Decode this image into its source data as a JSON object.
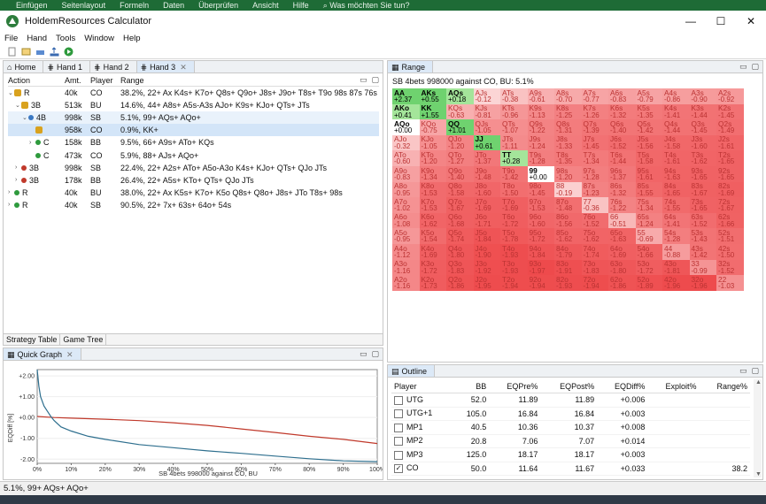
{
  "ribbon": [
    "Einfügen",
    "Seitenlayout",
    "Formeln",
    "Daten",
    "Überprüfen",
    "Ansicht",
    "Hilfe",
    "Was möchten Sie tun?"
  ],
  "window": {
    "title": "HoldemResources Calculator",
    "min": "—",
    "max": "☐",
    "close": "✕"
  },
  "menu": [
    "File",
    "Hand",
    "Tools",
    "Window",
    "Help"
  ],
  "left_tabs": [
    "Home",
    "Hand 1",
    "Hand 2",
    "Hand 3"
  ],
  "tree": {
    "headers": {
      "action": "Action",
      "amt": "Amt.",
      "player": "Player",
      "range": "Range"
    },
    "rows": [
      {
        "action": "R",
        "amt": "40k",
        "player": "CO",
        "range": "38.2%, 22+ Ax K4s+ K7o+ Q8s+ Q9o+ J8s+ J9o+ T8s+ T9o 98s 87s 76s 65s"
      },
      {
        "action": "3B",
        "amt": "513k",
        "player": "BU",
        "range": "14.6%, 44+ A8s+ A5s-A3s AJo+ K9s+ KJo+ QTs+ JTs"
      },
      {
        "action": "4B",
        "amt": "998k",
        "player": "SB",
        "range": "5.1%, 99+ AQs+ AQo+"
      },
      {
        "action": "",
        "amt": "958k",
        "player": "CO",
        "range": "0.9%, KK+"
      },
      {
        "action": "C",
        "amt": "158k",
        "player": "BB",
        "range": "9.5%, 66+ A9s+ ATo+ KQs"
      },
      {
        "action": "C",
        "amt": "473k",
        "player": "CO",
        "range": "5.9%, 88+ AJs+ AQo+"
      },
      {
        "action": "3B",
        "amt": "998k",
        "player": "SB",
        "range": "22.4%, 22+ A2s+ ATo+ A5o-A3o K4s+ KJo+ QTs+ QJo JTs"
      },
      {
        "action": "3B",
        "amt": "178k",
        "player": "BB",
        "range": "26.4%, 22+ A5s+ KTo+ QTs+ QJo JTs"
      },
      {
        "action": "R",
        "amt": "40k",
        "player": "BU",
        "range": "38.0%, 22+ Ax K5s+ K7o+ K5o Q8s+ Q8o+ J8s+ JTo T8s+ 98s"
      },
      {
        "action": "R",
        "amt": "40k",
        "player": "SB",
        "range": "90.5%, 22+ 7x+ 63s+ 64o+ 54s"
      }
    ]
  },
  "bottom_tabs": [
    "Strategy Table",
    "Game Tree"
  ],
  "quick_graph": {
    "tab": "Quick Graph",
    "chart_data": {
      "type": "line",
      "xlabel": "SB 4bets 998000 against CO, BU",
      "ylabel": "EQDiff [%]",
      "x_ticks": [
        "0%",
        "10%",
        "20%",
        "30%",
        "40%",
        "50%",
        "60%",
        "70%",
        "80%",
        "90%",
        "100%"
      ],
      "y_ticks": [
        "+2.00",
        "+1.00",
        "+0.00",
        "-1.00",
        "-2.00"
      ],
      "ylim": [
        -2.2,
        2.3
      ],
      "series": [
        {
          "color": "#c0392b",
          "x": [
            0,
            5,
            10,
            20,
            30,
            40,
            50,
            60,
            70,
            80,
            90,
            100
          ],
          "y": [
            0.05,
            0.0,
            -0.03,
            -0.08,
            -0.15,
            -0.25,
            -0.38,
            -0.55,
            -0.72,
            -0.9,
            -1.05,
            -1.25
          ]
        },
        {
          "color": "#2e6f8e",
          "x": [
            0,
            0.5,
            1,
            2,
            3,
            4,
            5,
            7,
            10,
            15,
            20,
            30,
            40,
            50,
            60,
            70,
            80,
            90,
            100
          ],
          "y": [
            2.3,
            1.5,
            1.0,
            0.55,
            0.3,
            0.05,
            -0.15,
            -0.45,
            -0.65,
            -0.9,
            -1.05,
            -1.3,
            -1.45,
            -1.6,
            -1.72,
            -1.85,
            -1.98,
            -2.08,
            -2.12
          ]
        }
      ]
    }
  },
  "range_panel": {
    "tab": "Range",
    "header": "SB 4bets 998000 against CO, BU: 5.1%",
    "cells": [
      [
        "AA",
        "+2.37"
      ],
      [
        "AKs",
        "+0.55"
      ],
      [
        "AQs",
        "+0.18"
      ],
      [
        "AJs",
        "-0.12"
      ],
      [
        "ATs",
        "-0.38"
      ],
      [
        "A9s",
        "-0.61"
      ],
      [
        "A8s",
        "-0.70"
      ],
      [
        "A7s",
        "-0.77"
      ],
      [
        "A6s",
        "-0.83"
      ],
      [
        "A5s",
        "-0.79"
      ],
      [
        "A4s",
        "-0.86"
      ],
      [
        "A3s",
        "-0.90"
      ],
      [
        "A2s",
        "-0.92"
      ],
      [
        "AKo",
        "+0.41"
      ],
      [
        "KK",
        "+1.55"
      ],
      [
        "KQs",
        "-0.63"
      ],
      [
        "KJs",
        "-0.81"
      ],
      [
        "KTs",
        "-0.96"
      ],
      [
        "K9s",
        "-1.13"
      ],
      [
        "K8s",
        "-1.25"
      ],
      [
        "K7s",
        "-1.26"
      ],
      [
        "K6s",
        "-1.32"
      ],
      [
        "K5s",
        "-1.35"
      ],
      [
        "K4s",
        "-1.41"
      ],
      [
        "K3s",
        "-1.44"
      ],
      [
        "K2s",
        "-1.45"
      ],
      [
        "AQo",
        "+0.00"
      ],
      [
        "KQo",
        "-0.75"
      ],
      [
        "QQ",
        "+1.01"
      ],
      [
        "QJs",
        "-1.05"
      ],
      [
        "QTs",
        "-1.07"
      ],
      [
        "Q9s",
        "-1.22"
      ],
      [
        "Q8s",
        "-1.31"
      ],
      [
        "Q7s",
        "-1.39"
      ],
      [
        "Q6s",
        "-1.40"
      ],
      [
        "Q5s",
        "-1.42"
      ],
      [
        "Q4s",
        "-1.44"
      ],
      [
        "Q3s",
        "-1.45"
      ],
      [
        "Q2s",
        "-1.49"
      ],
      [
        "AJo",
        "-0.32"
      ],
      [
        "KJo",
        "-1.05"
      ],
      [
        "QJo",
        "-1.20"
      ],
      [
        "JJ",
        "+0.61"
      ],
      [
        "JTs",
        "-1.11"
      ],
      [
        "J9s",
        "-1.24"
      ],
      [
        "J8s",
        "-1.33"
      ],
      [
        "J7s",
        "-1.45"
      ],
      [
        "J6s",
        "-1.52"
      ],
      [
        "J5s",
        "-1.56"
      ],
      [
        "J4s",
        "-1.58"
      ],
      [
        "J3s",
        "-1.60"
      ],
      [
        "J2s",
        "-1.61"
      ],
      [
        "ATo",
        "-0.60"
      ],
      [
        "KTo",
        "-1.20"
      ],
      [
        "QTo",
        "-1.27"
      ],
      [
        "JTo",
        "-1.37"
      ],
      [
        "TT",
        "+0.28"
      ],
      [
        "T9s",
        "-1.28"
      ],
      [
        "T8s",
        "-1.35"
      ],
      [
        "T7s",
        "-1.34"
      ],
      [
        "T6s",
        "-1.44"
      ],
      [
        "T5s",
        "-1.58"
      ],
      [
        "T4s",
        "-1.61"
      ],
      [
        "T3s",
        "-1.62"
      ],
      [
        "T2s",
        "-1.65"
      ],
      [
        "A9o",
        "-0.83"
      ],
      [
        "K9o",
        "-1.34"
      ],
      [
        "Q9o",
        "-1.40"
      ],
      [
        "J9o",
        "-1.48"
      ],
      [
        "T9o",
        "-1.42"
      ],
      [
        "99",
        "+0.00"
      ],
      [
        "98s",
        "-1.20"
      ],
      [
        "97s",
        "-1.28"
      ],
      [
        "96s",
        "-1.37"
      ],
      [
        "95s",
        "-1.61"
      ],
      [
        "94s",
        "-1.63"
      ],
      [
        "93s",
        "-1.65"
      ],
      [
        "92s",
        "-1.65"
      ],
      [
        "A8o",
        "-0.95"
      ],
      [
        "K8o",
        "-1.53"
      ],
      [
        "Q8o",
        "-1.58"
      ],
      [
        "J8o",
        "-1.60"
      ],
      [
        "T8o",
        "-1.50"
      ],
      [
        "98o",
        "-1.45"
      ],
      [
        "88",
        "-0.19"
      ],
      [
        "87s",
        "-1.23"
      ],
      [
        "86s",
        "-1.32"
      ],
      [
        "85s",
        "-1.55"
      ],
      [
        "84s",
        "-1.65"
      ],
      [
        "83s",
        "-1.67"
      ],
      [
        "82s",
        "-1.69"
      ],
      [
        "A7o",
        "-1.02"
      ],
      [
        "K7o",
        "-1.53"
      ],
      [
        "Q7o",
        "-1.67"
      ],
      [
        "J7o",
        "-1.69"
      ],
      [
        "T7o",
        "-1.69"
      ],
      [
        "97o",
        "-1.53"
      ],
      [
        "87o",
        "-1.48"
      ],
      [
        "77",
        "-0.36"
      ],
      [
        "76s",
        "-1.22"
      ],
      [
        "75s",
        "-1.34"
      ],
      [
        "74s",
        "-1.55"
      ],
      [
        "73s",
        "-1.65"
      ],
      [
        "72s",
        "-1.67"
      ],
      [
        "A6o",
        "-1.08"
      ],
      [
        "K6o",
        "-1.62"
      ],
      [
        "Q6o",
        "-1.68"
      ],
      [
        "J6o",
        "-1.71"
      ],
      [
        "T6o",
        "-1.72"
      ],
      [
        "96o",
        "-1.60"
      ],
      [
        "86o",
        "-1.56"
      ],
      [
        "76o",
        "-1.52"
      ],
      [
        "66",
        "-0.51"
      ],
      [
        "65s",
        "-1.24"
      ],
      [
        "64s",
        "-1.41"
      ],
      [
        "63s",
        "-1.52"
      ],
      [
        "62s",
        "-1.66"
      ],
      [
        "A5o",
        "-0.95"
      ],
      [
        "K5o",
        "-1.54"
      ],
      [
        "Q5o",
        "-1.74"
      ],
      [
        "J5o",
        "-1.84"
      ],
      [
        "T5o",
        "-1.78"
      ],
      [
        "95o",
        "-1.72"
      ],
      [
        "85o",
        "-1.62"
      ],
      [
        "75o",
        "-1.62"
      ],
      [
        "65o",
        "-1.63"
      ],
      [
        "55",
        "-0.69"
      ],
      [
        "54s",
        "-1.28"
      ],
      [
        "53s",
        "-1.43"
      ],
      [
        "52s",
        "-1.51"
      ],
      [
        "A4o",
        "-1.12"
      ],
      [
        "K4o",
        "-1.69"
      ],
      [
        "Q4o",
        "-1.80"
      ],
      [
        "J4o",
        "-1.90"
      ],
      [
        "T4o",
        "-1.93"
      ],
      [
        "94o",
        "-1.84"
      ],
      [
        "84o",
        "-1.79"
      ],
      [
        "74o",
        "-1.74"
      ],
      [
        "64o",
        "-1.69"
      ],
      [
        "54o",
        "-1.66"
      ],
      [
        "44",
        "-0.88"
      ],
      [
        "43s",
        "-1.42"
      ],
      [
        "42s",
        "-1.50"
      ],
      [
        "A3o",
        "-1.16"
      ],
      [
        "K3o",
        "-1.72"
      ],
      [
        "Q3o",
        "-1.83"
      ],
      [
        "J3o",
        "-1.92"
      ],
      [
        "T3o",
        "-1.93"
      ],
      [
        "93o",
        "-1.97"
      ],
      [
        "83o",
        "-1.91"
      ],
      [
        "73o",
        "-1.83"
      ],
      [
        "63o",
        "-1.80"
      ],
      [
        "53o",
        "-1.72"
      ],
      [
        "43o",
        "-1.81"
      ],
      [
        "33",
        "-0.99"
      ],
      [
        "32s",
        "-1.52"
      ],
      [
        "A2o",
        "-1.16"
      ],
      [
        "K2o",
        "-1.73"
      ],
      [
        "Q2o",
        "-1.86"
      ],
      [
        "J2o",
        "-1.95"
      ],
      [
        "T2o",
        "-1.94"
      ],
      [
        "92o",
        "-1.94"
      ],
      [
        "82o",
        "-1.93"
      ],
      [
        "72o",
        "-1.94"
      ],
      [
        "62o",
        "-1.86"
      ],
      [
        "52o",
        "-1.89"
      ],
      [
        "42o",
        "-1.96"
      ],
      [
        "32o",
        "-1.96"
      ],
      [
        "22",
        "-1.03"
      ]
    ]
  },
  "outline": {
    "tab": "Outline",
    "headers": [
      "Player",
      "BB",
      "EQPre%",
      "EQPost%",
      "EQDiff%",
      "Exploit%",
      "Range%"
    ],
    "rows": [
      {
        "player": "UTG",
        "checked": false,
        "bb": "52.0",
        "pre": "11.89",
        "post": "11.89",
        "diff": "+0.006",
        "exploit": "",
        "range": ""
      },
      {
        "player": "UTG+1",
        "checked": false,
        "bb": "105.0",
        "pre": "16.84",
        "post": "16.84",
        "diff": "+0.003",
        "exploit": "",
        "range": ""
      },
      {
        "player": "MP1",
        "checked": false,
        "bb": "40.5",
        "pre": "10.36",
        "post": "10.37",
        "diff": "+0.008",
        "exploit": "",
        "range": ""
      },
      {
        "player": "MP2",
        "checked": false,
        "bb": "20.8",
        "pre": "7.06",
        "post": "7.07",
        "diff": "+0.014",
        "exploit": "",
        "range": ""
      },
      {
        "player": "MP3",
        "checked": false,
        "bb": "125.0",
        "pre": "18.17",
        "post": "18.17",
        "diff": "+0.003",
        "exploit": "",
        "range": ""
      },
      {
        "player": "CO",
        "checked": true,
        "bb": "50.0",
        "pre": "11.64",
        "post": "11.67",
        "diff": "+0.033",
        "exploit": "",
        "range": "38.2"
      }
    ]
  },
  "status": "5.1%, 99+ AQs+ AQo+"
}
